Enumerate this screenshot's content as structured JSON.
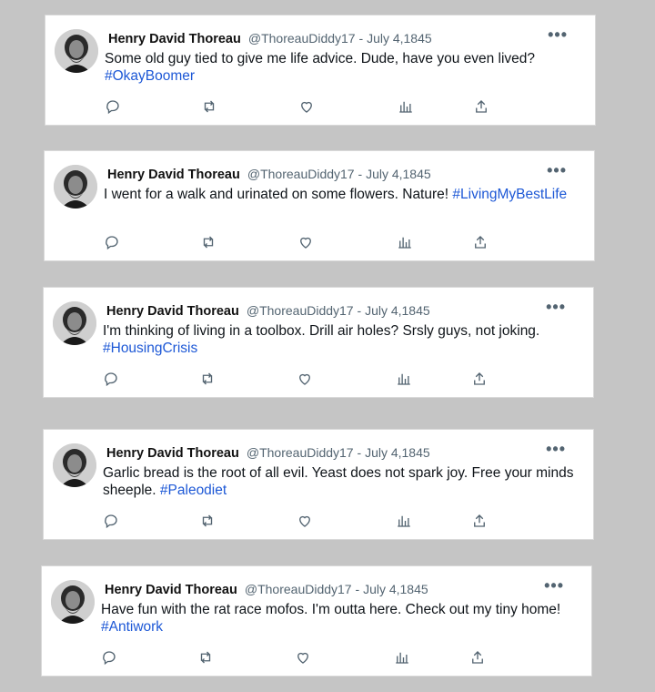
{
  "author": {
    "name": "Henry David Thoreau",
    "handle": "@ThoreauDiddy17",
    "date": "July 4,1845"
  },
  "more_label": "•••",
  "tweets": [
    {
      "text": "Some old guy tied to give me life advice. Dude, have you even lived?",
      "hashtag": "#OkayBoomer"
    },
    {
      "text": "I went for a walk and urinated on some flowers. Nature!",
      "hashtag": "#LivingMyBestLife"
    },
    {
      "text": "I'm thinking of living in a toolbox. Drill air holes? Srsly guys, not joking.",
      "hashtag": "#HousingCrisis"
    },
    {
      "text": "Garlic bread is the root of all evil. Yeast does not spark joy. Free your minds sheeple.",
      "hashtag": "#Paleodiet"
    },
    {
      "text": "Have fun with the rat race mofos. I'm outta here. Check out my tiny home!",
      "hashtag": "#Antiwork"
    }
  ],
  "actions": [
    "reply-icon",
    "retweet-icon",
    "like-icon",
    "views-icon",
    "share-icon"
  ],
  "colors": {
    "background": "#c5c5c5",
    "card": "#ffffff",
    "hashtag": "#1d58d6",
    "icon": "#536471"
  }
}
